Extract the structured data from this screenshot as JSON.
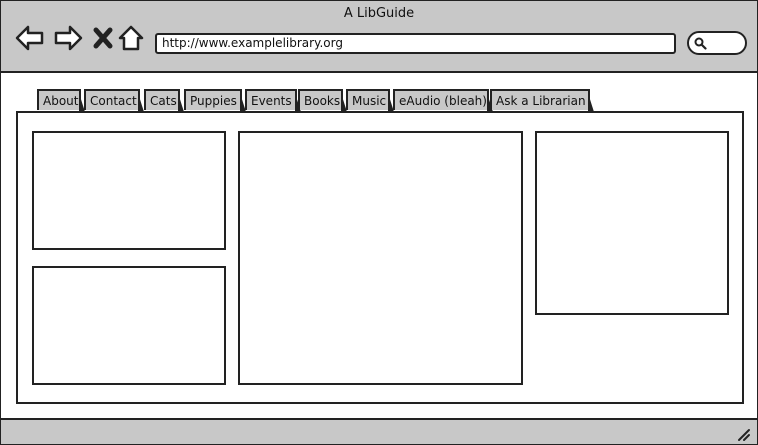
{
  "window": {
    "title": "A LibGuide"
  },
  "browser": {
    "url": "http://www.examplelibrary.org",
    "icons": [
      "back-arrow-icon",
      "forward-arrow-icon",
      "close-x-icon",
      "home-icon",
      "search-icon"
    ]
  },
  "tabs": [
    {
      "label": "About"
    },
    {
      "label": "Contact"
    },
    {
      "label": "Cats"
    },
    {
      "label": "Puppies"
    },
    {
      "label": "Events"
    },
    {
      "label": "Books"
    },
    {
      "label": "Music"
    },
    {
      "label": "eAudio (bleah)"
    },
    {
      "label": "Ask a Librarian"
    }
  ],
  "colors": {
    "chrome": "#c8c8c8",
    "stroke": "#222222"
  }
}
